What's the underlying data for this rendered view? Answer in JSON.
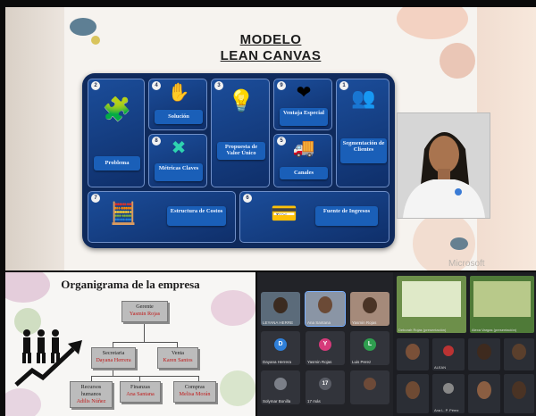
{
  "slide": {
    "title_line1": "MODELO",
    "title_line2": "LEAN CANVAS",
    "watermark": "Microsoft",
    "blocks": [
      {
        "num": "2",
        "label": "Problema",
        "icon": "puzzle-hands-icon"
      },
      {
        "num": "4",
        "label": "Solución",
        "icon": "hand-puzzle-icon"
      },
      {
        "num": "3",
        "label": "Propuesta de Valor Único",
        "icon": "lightbulb-icon"
      },
      {
        "num": "9",
        "label": "Ventaja Especial",
        "icon": "heart-hand-icon"
      },
      {
        "num": "1",
        "label": "Segmentación de Clientes",
        "icon": "people-group-icon"
      },
      {
        "num": "8",
        "label": "Métricas Claves",
        "icon": "tools-icon"
      },
      {
        "num": "5",
        "label": "Canales",
        "icon": "delivery-truck-icon"
      },
      {
        "num": "7",
        "label": "Estructura de Costos",
        "icon": "calculator-money-icon"
      },
      {
        "num": "6",
        "label": "Fuente de Ingresos",
        "icon": "cards-money-icon"
      }
    ]
  },
  "organigrama": {
    "title": "Organigrama de la empresa",
    "ceo": {
      "role": "Gerente",
      "name": "Yasmin Rojas"
    },
    "secretary": {
      "role": "Secretaria",
      "name": "Dayana Herrera"
    },
    "sales": {
      "role": "Venta",
      "name": "Karen Santos"
    },
    "hr": {
      "role": "Recursos humanos",
      "name": "Adilis Núñez"
    },
    "finance": {
      "role": "Finanzas",
      "name": "Ana Santana"
    },
    "purchasing": {
      "role": "Compras",
      "name": "Melisa Morán"
    }
  },
  "participants": {
    "row1": [
      {
        "name": "LEYANA HERRE",
        "initial": ""
      },
      {
        "name": "Ana Santana",
        "initial": ""
      },
      {
        "name": "Yasmin Rojas",
        "initial": ""
      }
    ],
    "row2": [
      {
        "name": "Dayana Herrera",
        "initial": "D",
        "color": "#2f7fd8"
      },
      {
        "name": "Yasmin Rojas",
        "initial": "Y",
        "color": "#d63a7a"
      },
      {
        "name": "Luis Perez",
        "initial": "L",
        "color": "#2f9e4f"
      }
    ],
    "row3": [
      {
        "name": "Solymar Bonilla",
        "initial": ""
      },
      {
        "name": "17 más",
        "initial": "17"
      },
      {
        "name": "",
        "initial": ""
      }
    ]
  },
  "mini_screens": {
    "top_left_caption": "Deborah Rojas (presentación)",
    "top_right_caption": "Alexa Vargas (presentación)",
    "bottom_names": [
      "",
      "ALEAN",
      "",
      "",
      "",
      "Ana L. P. Pérez",
      "",
      ""
    ]
  },
  "colors": {
    "board": "#0f2a5c",
    "cell": "#1b4d9a",
    "label": "#1a5fb8",
    "org_name_red": "#c01a1a"
  }
}
